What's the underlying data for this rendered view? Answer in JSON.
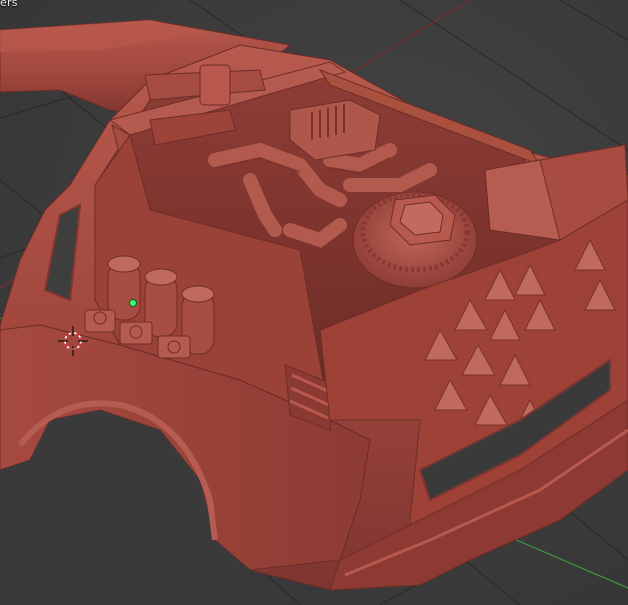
{
  "viewport": {
    "overlay_text": "ers",
    "background_color": "#3d3d3d",
    "grid_color": "#2a2a2a",
    "x_axis_color": "#8a2a2a",
    "y_axis_color": "#3f8f3f",
    "model_color": "#a34a40",
    "model_shadow_color": "#6e2d27",
    "model_highlight_color": "#c06a5e",
    "object_origin_color": "#3aff6a"
  },
  "icons": {
    "cursor": "3d-cursor-icon",
    "origin": "object-origin-icon"
  }
}
